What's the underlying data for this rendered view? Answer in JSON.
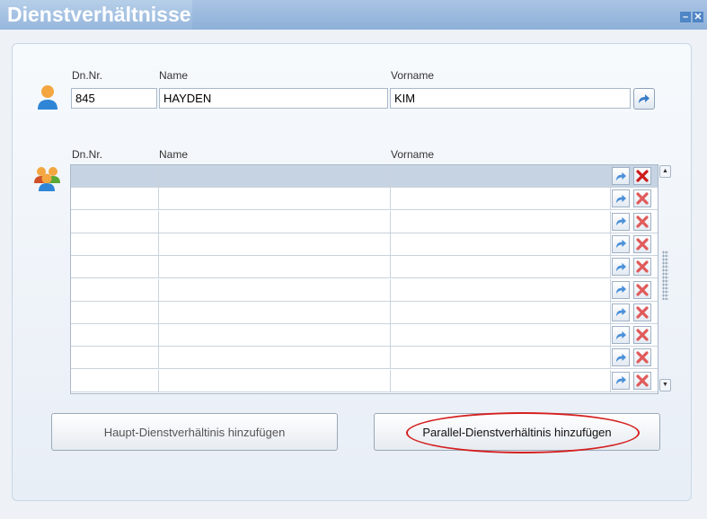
{
  "window": {
    "title": "Dienstverhältnisse",
    "minimize_glyph": "–",
    "close_glyph": "✕"
  },
  "current": {
    "labels": {
      "nr": "Dn.Nr.",
      "name": "Name",
      "vorname": "Vorname"
    },
    "values": {
      "nr": "845",
      "name": "HAYDEN",
      "vorname": "KIM"
    },
    "icon": "person-icon",
    "goto_icon": "arrow-forward-icon"
  },
  "list": {
    "labels": {
      "nr": "Dn.Nr.",
      "name": "Name",
      "vorname": "Vorname"
    },
    "icon": "group-icon",
    "row_count": 10,
    "selected_row": 0,
    "row_actions": [
      "arrow-forward-icon",
      "delete-x-icon"
    ]
  },
  "buttons": {
    "haupt": "Haupt-Dienstverhältinis hinzufügen",
    "parallel": "Parallel-Dienstverhältinis hinzufügen"
  },
  "colors": {
    "accent": "#4f86c6",
    "delete": "#d42020",
    "annotation": "#d42020",
    "selected_row": "#c6d3e2"
  }
}
